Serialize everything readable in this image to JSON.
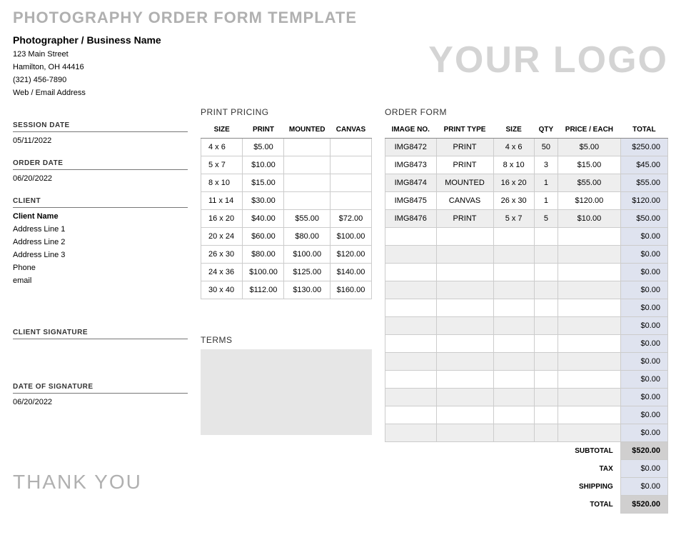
{
  "title": "PHOTOGRAPHY ORDER FORM TEMPLATE",
  "logo_text": "YOUR LOGO",
  "thank_you": "THANK YOU",
  "business": {
    "name": "Photographer / Business Name",
    "street": "123 Main Street",
    "city_state": "Hamilton, OH 44416",
    "phone": "(321) 456-7890",
    "web": "Web / Email Address"
  },
  "labels": {
    "session_date": "SESSION DATE",
    "order_date": "ORDER DATE",
    "client": "CLIENT",
    "client_signature": "CLIENT SIGNATURE",
    "date_of_signature": "DATE OF SIGNATURE",
    "print_pricing": "PRINT PRICING",
    "order_form": "ORDER FORM",
    "terms": "TERMS",
    "subtotal": "SUBTOTAL",
    "tax": "TAX",
    "shipping": "SHIPPING",
    "total": "TOTAL"
  },
  "values": {
    "session_date": "05/11/2022",
    "order_date": "06/20/2022",
    "date_of_signature": "06/20/2022"
  },
  "client": {
    "name": "Client Name",
    "addr1": "Address Line 1",
    "addr2": "Address Line 2",
    "addr3": "Address Line 3",
    "phone": "Phone",
    "email": "email"
  },
  "pricing": {
    "headers": {
      "size": "SIZE",
      "print": "PRINT",
      "mounted": "MOUNTED",
      "canvas": "CANVAS"
    },
    "rows": [
      {
        "size": "4 x 6",
        "print": "$5.00",
        "mounted": "",
        "canvas": ""
      },
      {
        "size": "5 x 7",
        "print": "$10.00",
        "mounted": "",
        "canvas": ""
      },
      {
        "size": "8 x 10",
        "print": "$15.00",
        "mounted": "",
        "canvas": ""
      },
      {
        "size": "11 x 14",
        "print": "$30.00",
        "mounted": "",
        "canvas": ""
      },
      {
        "size": "16 x 20",
        "print": "$40.00",
        "mounted": "$55.00",
        "canvas": "$72.00"
      },
      {
        "size": "20 x 24",
        "print": "$60.00",
        "mounted": "$80.00",
        "canvas": "$100.00"
      },
      {
        "size": "26 x 30",
        "print": "$80.00",
        "mounted": "$100.00",
        "canvas": "$120.00"
      },
      {
        "size": "24 x 36",
        "print": "$100.00",
        "mounted": "$125.00",
        "canvas": "$140.00"
      },
      {
        "size": "30 x 40",
        "print": "$112.00",
        "mounted": "$130.00",
        "canvas": "$160.00"
      }
    ]
  },
  "order": {
    "headers": {
      "image": "IMAGE NO.",
      "type": "PRINT TYPE",
      "size": "SIZE",
      "qty": "QTY",
      "price": "PRICE / EACH",
      "total": "TOTAL"
    },
    "rows": [
      {
        "image": "IMG8472",
        "type": "PRINT",
        "size": "4 x 6",
        "qty": "50",
        "price": "$5.00",
        "total": "$250.00"
      },
      {
        "image": "IMG8473",
        "type": "PRINT",
        "size": "8 x 10",
        "qty": "3",
        "price": "$15.00",
        "total": "$45.00"
      },
      {
        "image": "IMG8474",
        "type": "MOUNTED",
        "size": "16 x 20",
        "qty": "1",
        "price": "$55.00",
        "total": "$55.00"
      },
      {
        "image": "IMG8475",
        "type": "CANVAS",
        "size": "26 x 30",
        "qty": "1",
        "price": "$120.00",
        "total": "$120.00"
      },
      {
        "image": "IMG8476",
        "type": "PRINT",
        "size": "5 x 7",
        "qty": "5",
        "price": "$10.00",
        "total": "$50.00"
      },
      {
        "image": "",
        "type": "",
        "size": "",
        "qty": "",
        "price": "",
        "total": "$0.00"
      },
      {
        "image": "",
        "type": "",
        "size": "",
        "qty": "",
        "price": "",
        "total": "$0.00"
      },
      {
        "image": "",
        "type": "",
        "size": "",
        "qty": "",
        "price": "",
        "total": "$0.00"
      },
      {
        "image": "",
        "type": "",
        "size": "",
        "qty": "",
        "price": "",
        "total": "$0.00"
      },
      {
        "image": "",
        "type": "",
        "size": "",
        "qty": "",
        "price": "",
        "total": "$0.00"
      },
      {
        "image": "",
        "type": "",
        "size": "",
        "qty": "",
        "price": "",
        "total": "$0.00"
      },
      {
        "image": "",
        "type": "",
        "size": "",
        "qty": "",
        "price": "",
        "total": "$0.00"
      },
      {
        "image": "",
        "type": "",
        "size": "",
        "qty": "",
        "price": "",
        "total": "$0.00"
      },
      {
        "image": "",
        "type": "",
        "size": "",
        "qty": "",
        "price": "",
        "total": "$0.00"
      },
      {
        "image": "",
        "type": "",
        "size": "",
        "qty": "",
        "price": "",
        "total": "$0.00"
      },
      {
        "image": "",
        "type": "",
        "size": "",
        "qty": "",
        "price": "",
        "total": "$0.00"
      },
      {
        "image": "",
        "type": "",
        "size": "",
        "qty": "",
        "price": "",
        "total": "$0.00"
      }
    ]
  },
  "summary": {
    "subtotal": "$520.00",
    "tax": "$0.00",
    "shipping": "$0.00",
    "total": "$520.00"
  }
}
